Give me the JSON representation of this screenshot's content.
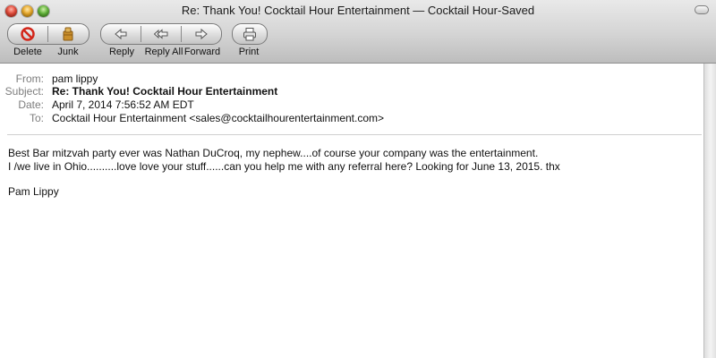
{
  "window": {
    "title": "Re: Thank You! Cocktail Hour Entertainment — Cocktail Hour-Saved"
  },
  "toolbar": {
    "delete_label": "Delete",
    "junk_label": "Junk",
    "reply_label": "Reply",
    "reply_all_label": "Reply All",
    "forward_label": "Forward",
    "print_label": "Print"
  },
  "header": {
    "from_label": "From:",
    "from_value": "pam lippy",
    "subject_label": "Subject:",
    "subject_value": "Re: Thank You! Cocktail Hour Entertainment",
    "date_label": "Date:",
    "date_value": "April 7, 2014 7:56:52 AM EDT",
    "to_label": "To:",
    "to_value": "Cocktail Hour Entertainment <sales@cocktailhourentertainment.com>"
  },
  "message": {
    "line1": "Best Bar mitzvah party ever was Nathan DuCroq, my nephew....of course your company was the entertainment.",
    "line2": "I /we live in Ohio..........love love your stuff......can you help me with any referral here? Looking for June 13, 2015. thx",
    "signature": "Pam Lippy"
  }
}
